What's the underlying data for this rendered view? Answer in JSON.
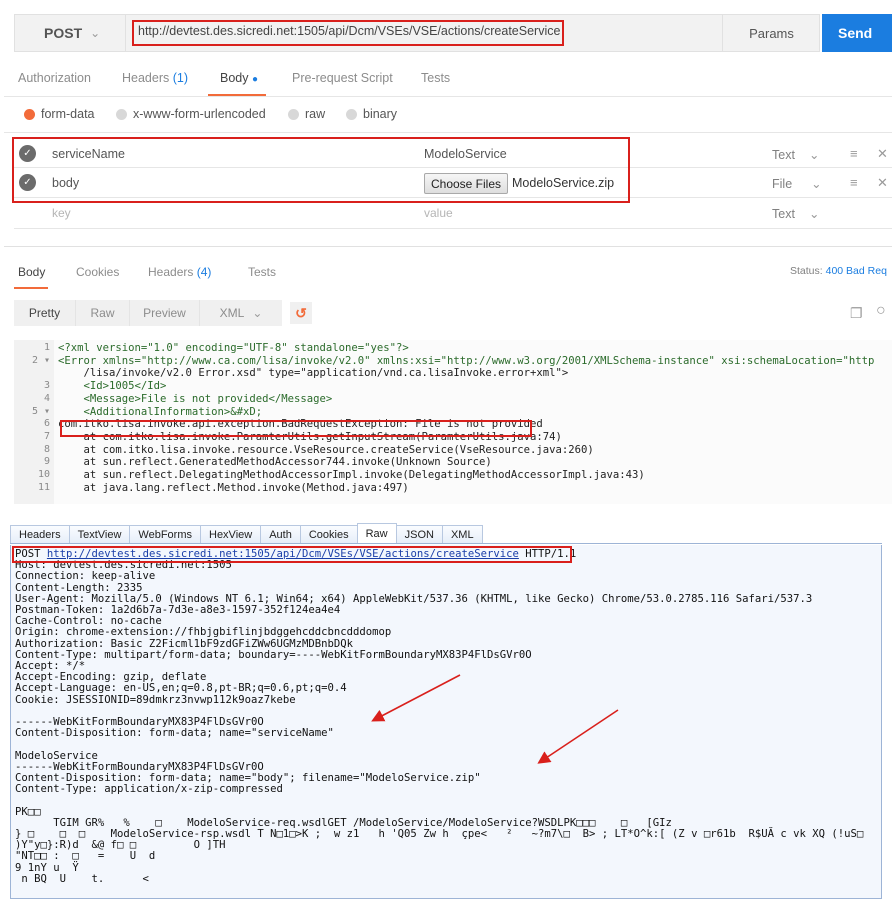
{
  "request": {
    "method": "POST",
    "url": "http://devtest.des.sicredi.net:1505/api/Dcm/VSEs/VSE/actions/createService",
    "params_label": "Params",
    "send_label": "Send"
  },
  "req_tabs": {
    "authorization": "Authorization",
    "headers": "Headers",
    "headers_count": "(1)",
    "body": "Body",
    "prerequest": "Pre-request Script",
    "tests": "Tests"
  },
  "body_modes": {
    "form_data": "form-data",
    "urlencoded": "x-www-form-urlencoded",
    "raw": "raw",
    "binary": "binary"
  },
  "form_rows": [
    {
      "key": "serviceName",
      "value": "ModeloService",
      "type": "Text"
    },
    {
      "key": "body",
      "choose_label": "Choose Files",
      "file_name": "ModeloService.zip",
      "type": "File"
    },
    {
      "key_placeholder": "key",
      "value_placeholder": "value",
      "type": "Text"
    }
  ],
  "response": {
    "tabs": {
      "body": "Body",
      "cookies": "Cookies",
      "headers": "Headers",
      "headers_count": "(4)",
      "tests": "Tests"
    },
    "status_label": "Status:",
    "status_value": "400 Bad Req",
    "view_modes": {
      "pretty": "Pretty",
      "raw": "Raw",
      "preview": "Preview",
      "format": "XML"
    },
    "lines": [
      {
        "num": "1",
        "text": "<?xml version=\"1.0\" encoding=\"UTF-8\" standalone=\"yes\"?>"
      },
      {
        "num": "2 ▾",
        "text": "<Error xmlns=\"http://www.ca.com/lisa/invoke/v2.0\" xmlns:xsi=\"http://www.w3.org/2001/XMLSchema-instance\" xsi:schemaLocation=\"http"
      },
      {
        "num": "",
        "text": "    /lisa/invoke/v2.0 Error.xsd\" type=\"application/vnd.ca.lisaInvoke.error+xml\">"
      },
      {
        "num": "3",
        "text": "    <Id>1005</Id>"
      },
      {
        "num": "4",
        "text": "    <Message>File is not provided</Message>"
      },
      {
        "num": "5 ▾",
        "text": "    <AdditionalInformation>&#xD;"
      },
      {
        "num": "6",
        "text": "com.itko.lisa.invoke.api.exception.BadRequestException: File is not provided"
      },
      {
        "num": "7",
        "text": "    at com.itko.lisa.invoke.ParamterUtils.getInputStream(ParamterUtils.java:74)"
      },
      {
        "num": "8",
        "text": "    at com.itko.lisa.invoke.resource.VseResource.createService(VseResource.java:260)"
      },
      {
        "num": "9",
        "text": "    at sun.reflect.GeneratedMethodAccessor744.invoke(Unknown Source)"
      },
      {
        "num": "10",
        "text": "    at sun.reflect.DelegatingMethodAccessorImpl.invoke(DelegatingMethodAccessorImpl.java:43)"
      },
      {
        "num": "11",
        "text": "    at java.lang.reflect.Method.invoke(Method.java:497)"
      }
    ]
  },
  "fiddler": {
    "tabs": [
      "Headers",
      "TextView",
      "WebForms",
      "HexView",
      "Auth",
      "Cookies",
      "Raw",
      "JSON",
      "XML"
    ],
    "active_tab": "Raw",
    "request_line": {
      "method": "POST",
      "url": "http://devtest.des.sicredi.net:1505/api/Dcm/VSEs/VSE/actions/createService",
      "version": "HTTP/1.1"
    },
    "raw_lines": [
      "Host: devtest.des.sicredi.net:1505",
      "Connection: keep-alive",
      "Content-Length: 2335",
      "User-Agent: Mozilla/5.0 (Windows NT 6.1; Win64; x64) AppleWebKit/537.36 (KHTML, like Gecko) Chrome/53.0.2785.116 Safari/537.3",
      "Postman-Token: 1a2d6b7a-7d3e-a8e3-1597-352f124ea4e4",
      "Cache-Control: no-cache",
      "Origin: chrome-extension://fhbjgbiflinjbdggehcddcbncdddomop",
      "Authorization: Basic Z2Ficml1bF9zdGFiZWw6UGMzMDBnbDQk",
      "Content-Type: multipart/form-data; boundary=----WebKitFormBoundaryMX83P4FlDsGVr0O",
      "Accept: */*",
      "Accept-Encoding: gzip, deflate",
      "Accept-Language: en-US,en;q=0.8,pt-BR;q=0.6,pt;q=0.4",
      "Cookie: JSESSIONID=89dmkrz3nvwp112k9oaz7kebe",
      "",
      "------WebKitFormBoundaryMX83P4FlDsGVr0O",
      "Content-Disposition: form-data; name=\"serviceName\"",
      "",
      "ModeloService",
      "------WebKitFormBoundaryMX83P4FlDsGVr0O",
      "Content-Disposition: form-data; name=\"body\"; filename=\"ModeloService.zip\"",
      "Content-Type: application/x-zip-compressed",
      "",
      "PK□□",
      "      TGIM GR%   %    □    ModeloService-req.wsdlGET /ModeloService/ModeloService?WSDLPK□□□    □   [GIz",
      "} □    □  □    ModeloService-rsp.wsdl T N□1□>K ;  w z1   h 'Q05 Zw h  çpe<   ²   ~?m7\\□  B> ; LT*O^k:[ (Z v □r61b  R$UĂ c vk XQ (!uS□",
      ")Y\"y□}:R)d  &@ f□ □         O ]TH",
      "\"NT□□ :  □   =    U  d",
      "9 1nY u  Ÿ",
      " n BQ  U    t.      <"
    ]
  }
}
